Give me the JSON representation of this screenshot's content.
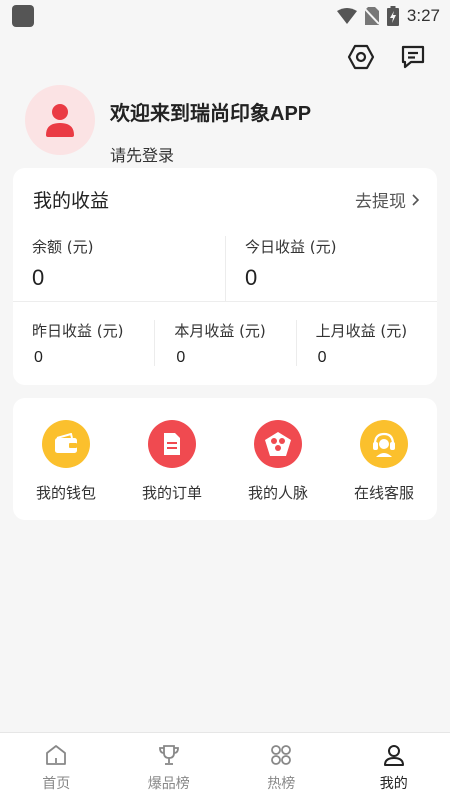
{
  "status_bar": {
    "time": "3:27"
  },
  "header": {
    "settings_icon": "hexagon-settings-icon",
    "message_icon": "chat-icon"
  },
  "profile": {
    "welcome": "欢迎来到瑞尚印象APP",
    "login_prompt": "请先登录"
  },
  "earnings": {
    "title": "我的收益",
    "withdraw": "去提现",
    "balance": {
      "label": "余额 (元)",
      "value": "0"
    },
    "today": {
      "label": "今日收益 (元)",
      "value": "0"
    },
    "yesterday": {
      "label": "昨日收益 (元)",
      "value": "0"
    },
    "this_month": {
      "label": "本月收益 (元)",
      "value": "0"
    },
    "last_month": {
      "label": "上月收益 (元)",
      "value": "0"
    }
  },
  "shortcuts": [
    {
      "label": "我的钱包",
      "icon": "wallet-icon",
      "color": "#fbc02d"
    },
    {
      "label": "我的订单",
      "icon": "document-icon",
      "color": "#f04a50"
    },
    {
      "label": "我的人脉",
      "icon": "network-icon",
      "color": "#f04a50"
    },
    {
      "label": "在线客服",
      "icon": "headset-icon",
      "color": "#fbc02d"
    }
  ],
  "bottom_nav": [
    {
      "label": "首页",
      "icon": "home-icon"
    },
    {
      "label": "爆品榜",
      "icon": "trophy-icon"
    },
    {
      "label": "热榜",
      "icon": "grid-icon"
    },
    {
      "label": "我的",
      "icon": "person-icon",
      "active": true
    }
  ],
  "colors": {
    "accent_red": "#f04a50",
    "accent_yellow": "#fbc02d",
    "avatar_bg": "#fbe3e4"
  }
}
